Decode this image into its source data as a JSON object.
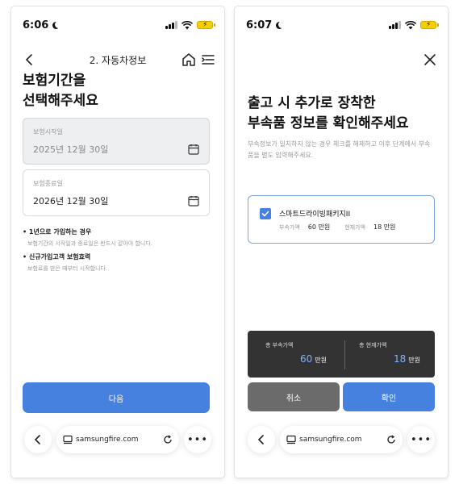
{
  "left": {
    "status": {
      "time": "6:06"
    },
    "nav": {
      "title": "2. 자동차정보"
    },
    "headline": [
      "보험기간을",
      "선택해주세요"
    ],
    "start": {
      "label": "보험시작일",
      "value": "2025년 12월 30일"
    },
    "end": {
      "label": "보험종료일",
      "value": "2026년 12월 30일"
    },
    "notes": [
      {
        "title": "• 1년으로 가입하는 경우",
        "desc": "보험기간의 시작일과 종료일은 반드시 같아야 합니다."
      },
      {
        "title": "• 신규가입고객 보험효력",
        "desc": "보험료를 받은 때부터 시작합니다."
      }
    ],
    "next_label": "다음",
    "browser": {
      "url": "samsungfire.com"
    }
  },
  "right": {
    "status": {
      "time": "6:07"
    },
    "headline": [
      "출고 시 추가로 장착한",
      "부속품 정보를 확인해주세요"
    ],
    "description": "부속정보가 일치하지 않는 경우 체크를 해제하고 이후 단계에서 부속품을 별도 입력해주세요.",
    "option": {
      "name": "스마트드라이빙패키지II",
      "checked": true,
      "price_label": "부속가액",
      "price": "60 만원",
      "current_label": "현재가액",
      "current": "18 만원"
    },
    "summary": {
      "total_price_label": "총 부속가액",
      "total_price": "60",
      "total_current_label": "총 현재가액",
      "total_current": "18",
      "unit": "만원"
    },
    "cancel_label": "취소",
    "confirm_label": "확인",
    "browser": {
      "url": "samsungfire.com"
    }
  },
  "colors": {
    "primary": "#4681e0",
    "summary_bg": "#333333",
    "summary_value": "#7fb2ff",
    "cancel_bg": "#6b6b6b"
  }
}
